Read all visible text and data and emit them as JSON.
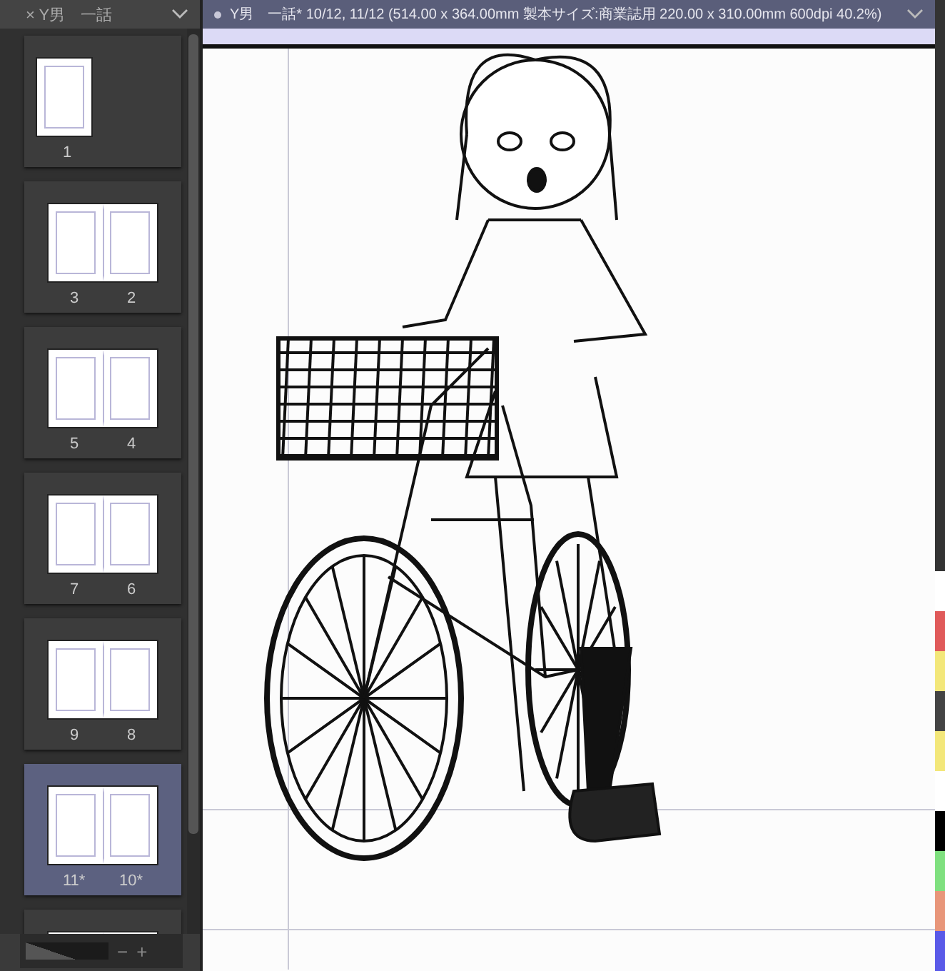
{
  "page_panel": {
    "tab": {
      "close": "×",
      "title": "Y男　一話"
    },
    "pages": [
      {
        "labels": [
          "1"
        ],
        "selected": false
      },
      {
        "labels": [
          "3",
          "2"
        ],
        "selected": false
      },
      {
        "labels": [
          "5",
          "4"
        ],
        "selected": false
      },
      {
        "labels": [
          "7",
          "6"
        ],
        "selected": false
      },
      {
        "labels": [
          "9",
          "8"
        ],
        "selected": false
      },
      {
        "labels": [
          "11*",
          "10*"
        ],
        "selected": true
      },
      {
        "selected": false
      }
    ],
    "zoom_slider": {
      "minus": "−",
      "plus": "+",
      "level": 0.6
    }
  },
  "document": {
    "title": "Y男　一話* 10/12, 11/12 (514.00 x 364.00mm 製本サイズ:商業誌用 220.00 x 310.00mm 600dpi 40.2%)"
  },
  "layer_colors": [
    {
      "color": "#ffffff"
    },
    {
      "color": "#e05a5a"
    },
    {
      "color": "#f3e77a"
    },
    {
      "color": "#444444"
    },
    {
      "color": "#f3e77a"
    },
    {
      "color": "#ffffff"
    },
    {
      "color": "#000000"
    },
    {
      "color": "#7fe07f"
    },
    {
      "color": "#e8967a"
    },
    {
      "color": "#5a5ae8"
    }
  ]
}
